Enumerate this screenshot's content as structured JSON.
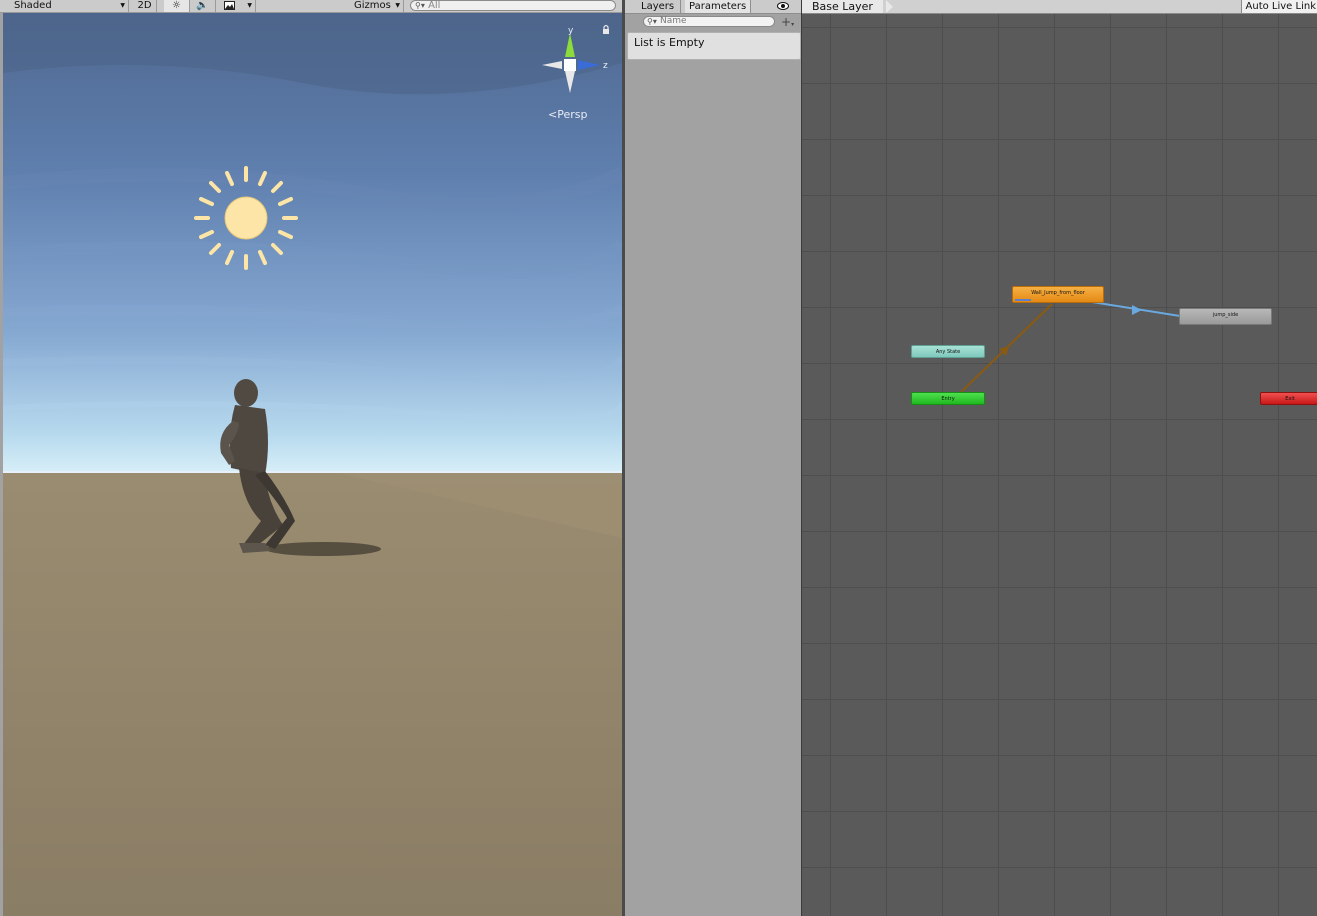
{
  "scene_toolbar": {
    "shading_mode": "Shaded",
    "mode_2d": "2D",
    "gizmos_label": "Gizmos",
    "search_placeholder": "All"
  },
  "scene_view": {
    "projection_label": "Persp",
    "gizmo_axes": {
      "y": "y",
      "z": "z"
    },
    "colors": {
      "sky_top": "#4f6890",
      "sky_horizon": "#c8e4f2",
      "ground": "#8c7f66",
      "sun": "#fce5a6"
    }
  },
  "animator_panel": {
    "tabs": [
      "Layers",
      "Parameters"
    ],
    "active_tab": "Parameters",
    "search_placeholder": "Name",
    "empty_message": "List is Empty",
    "visibility_icon": "eye-icon",
    "add_icon": "plus-dropdown-icon"
  },
  "animator_graph": {
    "breadcrumb": "Base Layer",
    "auto_live_link": "Auto Live Link",
    "states": {
      "wall_jump": "Wall_Jump_from_floor",
      "jump_side": "jump_side",
      "any_state": "Any State",
      "entry": "Entry",
      "exit": "Exit"
    },
    "colors": {
      "background": "#5a5a5a",
      "default_state": "#e48914",
      "transition_default": "#8a5a10",
      "transition_active": "#6aa8e0"
    }
  }
}
